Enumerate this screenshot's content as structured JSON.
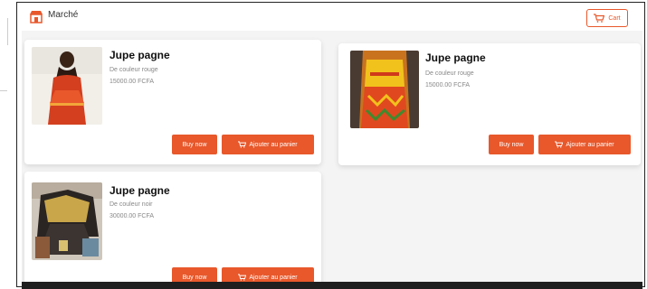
{
  "header": {
    "title": "Marché",
    "cart_label": "Cart"
  },
  "products": [
    {
      "title": "Jupe pagne",
      "line1": "De couleur rouge",
      "line2": "15000.00 FCFA",
      "buy_label": "Buy now",
      "add_label": "Ajouter au panier"
    },
    {
      "title": "Jupe pagne",
      "line1": "De couleur rouge",
      "line2": "15000.00 FCFA",
      "buy_label": "Buy now",
      "add_label": "Ajouter au panier"
    },
    {
      "title": "Jupe pagne",
      "line1": "De couleur noir",
      "line2": "30000.00 FCFA",
      "buy_label": "Buy now",
      "add_label": "Ajouter au panier"
    }
  ],
  "colors": {
    "accent": "#e8582b",
    "background": "#f4f4f4",
    "card": "#ffffff"
  },
  "icons": {
    "logo": "store-icon",
    "cart": "cart-icon"
  }
}
